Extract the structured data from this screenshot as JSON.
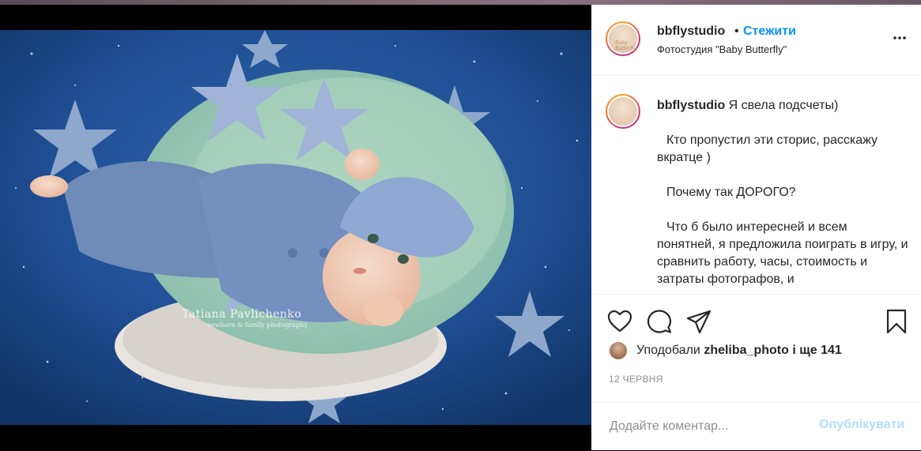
{
  "post": {
    "username": "bbflystudio",
    "separator": "•",
    "follow_label": "Стежити",
    "location": "Фотостудия \"Baby Butterfly\"",
    "avatar_text": "Baby Butterfly",
    "watermark_name": "Tatiana Pavlichenko",
    "watermark_sub": "newborn & family photography"
  },
  "caption": {
    "username": "bbflystudio",
    "lines": [
      "Я свела подсчеты)",
      "Кто пропустил эти сторис, расскажу вкратце )",
      "Почему так ДОРОГО?",
      "Что б было интересней и всем понятней, я предложила поиграть в игру, и сравнить работу, часы, стоимость и затраты фотографов, и"
    ]
  },
  "actions": {
    "like_icon": "heart-icon",
    "comment_icon": "comment-icon",
    "share_icon": "paper-plane-icon",
    "save_icon": "bookmark-icon"
  },
  "likes": {
    "prefix": "Уподобали",
    "user": "zheliba_photo",
    "suffix": "і ще 141"
  },
  "date": "12 ЧЕРВНЯ",
  "comment_box": {
    "placeholder": "Додайте коментар...",
    "publish_label": "Опублікувати"
  },
  "colors": {
    "accent": "#0095f6",
    "publish_disabled": "#b2dffc",
    "background": "#000000"
  }
}
